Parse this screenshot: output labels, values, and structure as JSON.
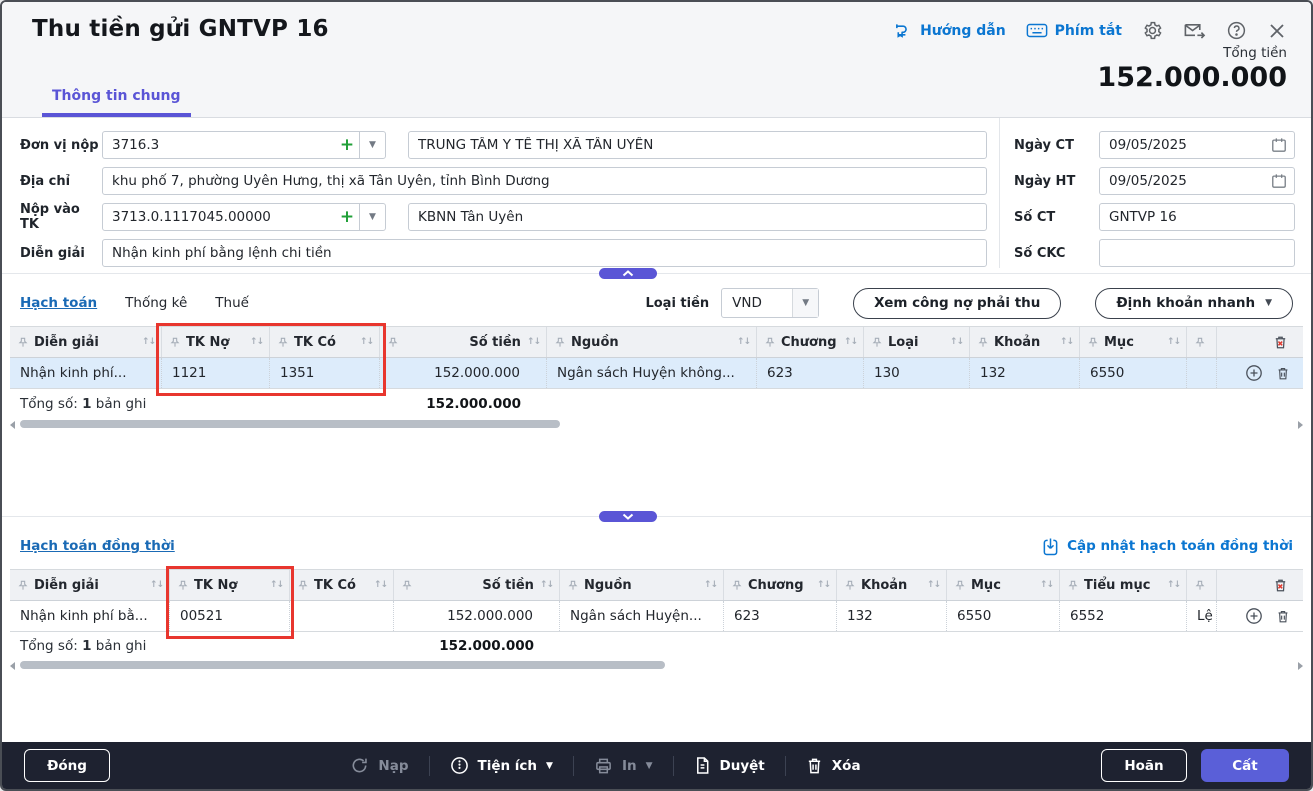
{
  "window": {
    "title": "Thu tiền gửi GNTVP 16",
    "help_link": "Hướng dẫn",
    "shortcut_link": "Phím tắt",
    "total_label": "Tổng tiền",
    "total_value": "152.000.000",
    "tab": "Thông tin chung"
  },
  "form": {
    "unit_label": "Đơn vị nộp",
    "unit_code": "3716.3",
    "unit_name": "TRUNG TÂM Y TẾ THỊ XÃ TÂN UYÊN",
    "address_label": "Địa chỉ",
    "address": "khu phố 7, phường Uyên Hưng, thị xã Tân Uyên, tỉnh Bình Dương",
    "account_label": "Nộp vào TK",
    "account_code": "3713.0.1117045.00000",
    "account_name": "KBNN Tân Uyên",
    "desc_label": "Diễn giải",
    "desc": "Nhận kinh phí bằng lệnh chi tiền",
    "date_ct_label": "Ngày CT",
    "date_ct": "09/05/2025",
    "date_ht_label": "Ngày HT",
    "date_ht": "09/05/2025",
    "doc_no_label": "Số CT",
    "doc_no": "GNTVP 16",
    "ckc_label": "Số CKC",
    "ckc": ""
  },
  "accounting": {
    "tab_main": "Hạch toán",
    "tab_stats": "Thống kê",
    "tab_tax": "Thuế",
    "currency_label": "Loại tiền",
    "currency": "VND",
    "btn_receivable": "Xem công nợ phải thu",
    "btn_quick": "Định khoản nhanh",
    "columns": [
      "Diễn giải",
      "TK Nợ",
      "TK Có",
      "Số tiền",
      "Nguồn",
      "Chương",
      "Loại",
      "Khoản",
      "Mục"
    ],
    "row": [
      "Nhận kinh phí...",
      "1121",
      "1351",
      "152.000.000",
      "Ngân sách Huyện không...",
      "623",
      "130",
      "132",
      "6550"
    ],
    "total_label": "Tổng số:",
    "total_count": "1",
    "total_unit": "bản ghi",
    "total_amount": "152.000.000"
  },
  "simultaneous": {
    "title": "Hạch toán đồng thời",
    "update_link": "Cập nhật hạch toán đồng thời",
    "columns": [
      "Diễn giải",
      "TK Nợ",
      "TK Có",
      "Số tiền",
      "Nguồn",
      "Chương",
      "Khoản",
      "Mục",
      "Tiểu mục"
    ],
    "row": [
      "Nhận kinh phí bằ...",
      "00521",
      "",
      "152.000.000",
      "Ngân sách Huyện...",
      "623",
      "132",
      "6550",
      "6552"
    ],
    "row_partial": "Lệ",
    "total_label": "Tổng số:",
    "total_count": "1",
    "total_unit": "bản ghi",
    "total_amount": "152.000.000"
  },
  "footer": {
    "close": "Đóng",
    "load": "Nạp",
    "utilities": "Tiện ích",
    "print": "In",
    "approve": "Duyệt",
    "delete": "Xóa",
    "postpone": "Hoãn",
    "save": "Cất"
  },
  "icons": {
    "header": [
      "guide-icon",
      "keyboard-icon",
      "gear-icon",
      "mail-send-icon",
      "help-icon",
      "close-icon"
    ],
    "table": [
      "pin-icon",
      "sort-icon",
      "circle-plus-icon",
      "trash-icon",
      "trash-x-icon"
    ],
    "footer": [
      "refresh-icon",
      "utilities-circle-icon",
      "printer-icon",
      "document-icon",
      "trash-icon"
    ]
  },
  "colors": {
    "accent": "#5a55d6",
    "link_blue": "#0b76d1",
    "highlight_red": "#e8362e",
    "selected_row": "#ddecfb",
    "footer_bg": "#1e2230"
  }
}
